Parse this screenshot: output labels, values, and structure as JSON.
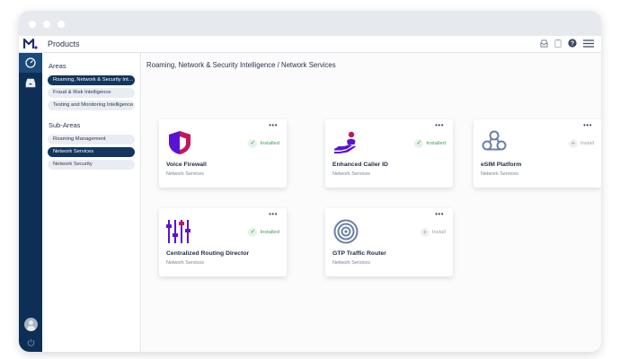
{
  "app": {
    "title": "Products"
  },
  "sidebar": {
    "areas_heading": "Areas",
    "areas": [
      {
        "label": "Roaming, Network & Security Intelligence",
        "selected": true
      },
      {
        "label": "Fraud & Risk Intelligence",
        "selected": false
      },
      {
        "label": "Testing and Monitoring Intelligence",
        "selected": false
      }
    ],
    "subareas_heading": "Sub-Areas",
    "subareas": [
      {
        "label": "Roaming Management",
        "selected": false
      },
      {
        "label": "Network Services",
        "selected": true
      },
      {
        "label": "Network Security",
        "selected": false
      }
    ]
  },
  "main": {
    "breadcrumb": "Roaming, Network & Security Intelligence / Network Services",
    "more_label": "•••",
    "cards": [
      {
        "name": "Voice Firewall",
        "category": "Network Services",
        "status": "Installed",
        "installed": true,
        "icon": "shield-icon"
      },
      {
        "name": "Enhanced Caller ID",
        "category": "Network Services",
        "status": "Installed",
        "installed": true,
        "icon": "hand-person-icon"
      },
      {
        "name": "eSIM Platform",
        "category": "Network Services",
        "status": "Install",
        "installed": false,
        "icon": "cloud-network-icon"
      },
      {
        "name": "Centralized Routing Director",
        "category": "Network Services",
        "status": "Installed",
        "installed": true,
        "icon": "sliders-icon"
      },
      {
        "name": "GTP Traffic Router",
        "category": "Network Services",
        "status": "Install",
        "installed": false,
        "icon": "target-icon"
      }
    ]
  },
  "colors": {
    "rail": "#0d2f55",
    "accent_purple": "#5a12d6",
    "installed_green": "#3a9d5d",
    "selected_pill": "#12365f"
  }
}
